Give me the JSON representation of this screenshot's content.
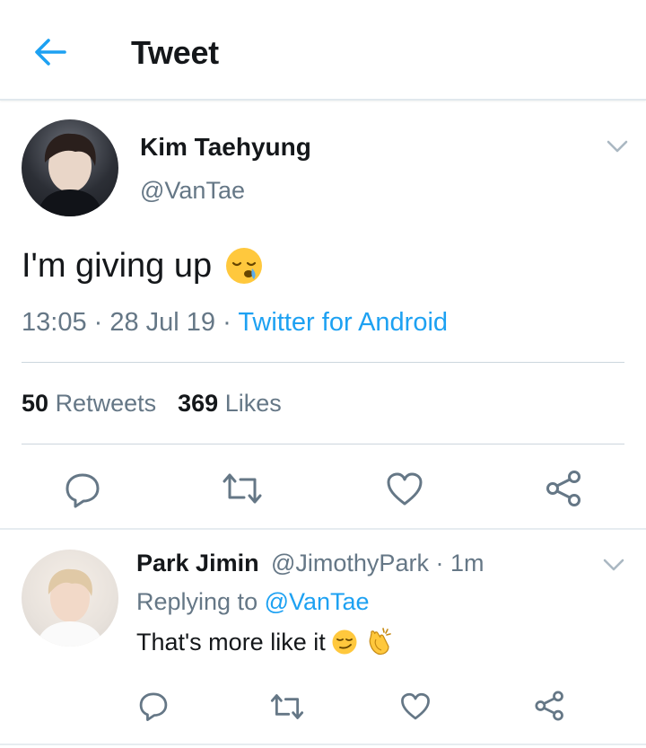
{
  "header": {
    "title": "Tweet",
    "back_icon": "back-arrow-icon"
  },
  "colors": {
    "accent": "#1da1f2",
    "secondary_text": "#657786",
    "primary_text": "#14171a",
    "divider": "#e1e8ed"
  },
  "tweet": {
    "author_name": "Kim Taehyung",
    "author_handle": "@VanTae",
    "text": "I'm giving up",
    "emoji": "sleepy-face",
    "time": "13:05",
    "sep1": " · ",
    "date": "28 Jul 19",
    "sep2": " · ",
    "source": "Twitter for Android",
    "retweet_count": "50",
    "retweet_label": "Retweets",
    "like_count": "369",
    "like_label": "Likes"
  },
  "reply": {
    "author_name": "Park Jimin",
    "author_handle": "@JimothyPark",
    "sep": " · ",
    "time": "1m",
    "replying_prefix": "Replying to ",
    "replying_to": "@VanTae",
    "text": "That's more like it",
    "emojis": [
      "smirking-face",
      "clapping-hands"
    ]
  }
}
